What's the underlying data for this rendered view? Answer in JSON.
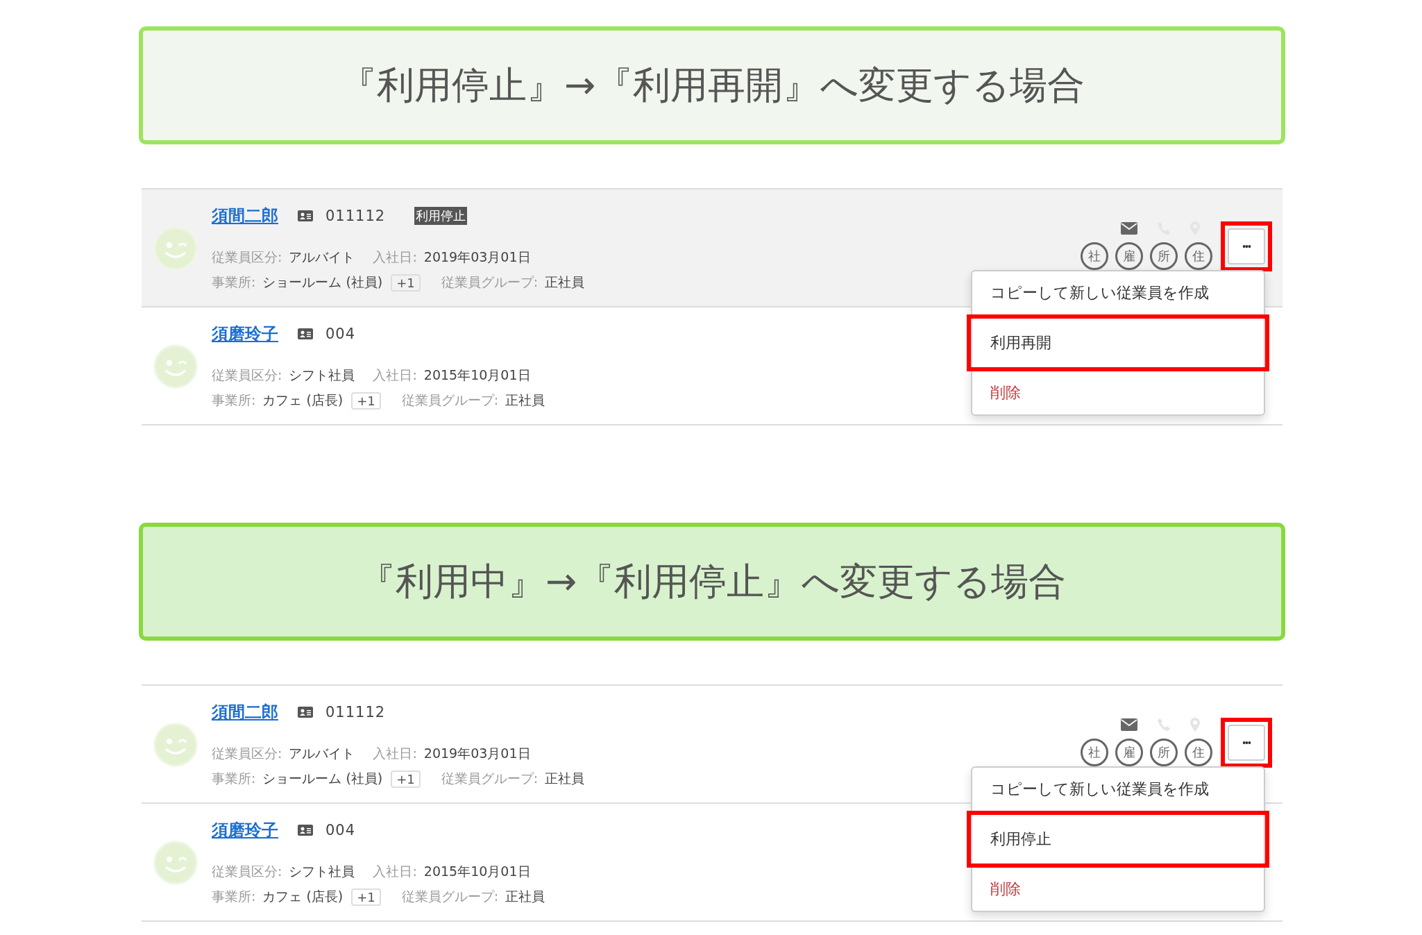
{
  "sections": [
    {
      "banner": {
        "title": "『利用停止』→『利用再開』へ変更する場合",
        "color": "#f1f6ee"
      },
      "employees": [
        {
          "name": "須間二郎",
          "employee_no": "011112",
          "status_tag": "利用停止",
          "hovered": true,
          "category_label": "従業員区分:",
          "category": "アルバイト",
          "hire_label": "入社日:",
          "hire_date": "2019年03月01日",
          "office_label": "事業所:",
          "office": "ショールーム (社員)",
          "office_extra": "+1",
          "group_label": "従業員グループ:",
          "group": "正社員",
          "contacts": [
            {
              "kind": "mail",
              "disabled": false
            },
            {
              "kind": "phone",
              "disabled": true
            },
            {
              "kind": "pin",
              "disabled": true
            }
          ],
          "badges": [
            "社",
            "雇",
            "所",
            "住"
          ],
          "more_button": {
            "label": "•••",
            "marked": true
          },
          "menu": [
            {
              "label": "コピーして新しい従業員を作成",
              "kind": "normal",
              "marked": false
            },
            {
              "label": "利用再開",
              "kind": "normal",
              "marked": true
            },
            {
              "label": "削除",
              "kind": "danger",
              "marked": false
            }
          ]
        },
        {
          "name": "須磨玲子",
          "employee_no": "004",
          "hovered": false,
          "category_label": "従業員区分:",
          "category": "シフト社員",
          "hire_label": "入社日:",
          "hire_date": "2015年10月01日",
          "office_label": "事業所:",
          "office": "カフェ (店長)",
          "office_extra": "+1",
          "group_label": "従業員グループ:",
          "group": "正社員"
        }
      ]
    },
    {
      "banner": {
        "title": "『利用中』→『利用停止』へ変更する場合",
        "color": "#d8f2cd"
      },
      "employees": [
        {
          "name": "須間二郎",
          "employee_no": "011112",
          "hovered": false,
          "category_label": "従業員区分:",
          "category": "アルバイト",
          "hire_label": "入社日:",
          "hire_date": "2019年03月01日",
          "office_label": "事業所:",
          "office": "ショールーム (社員)",
          "office_extra": "+1",
          "group_label": "従業員グループ:",
          "group": "正社員",
          "contacts": [
            {
              "kind": "mail",
              "disabled": false
            },
            {
              "kind": "phone",
              "disabled": true
            },
            {
              "kind": "pin",
              "disabled": true
            }
          ],
          "badges": [
            "社",
            "雇",
            "所",
            "住"
          ],
          "more_button": {
            "label": "•••",
            "marked": true
          },
          "menu": [
            {
              "label": "コピーして新しい従業員を作成",
              "kind": "normal",
              "marked": false
            },
            {
              "label": "利用停止",
              "kind": "normal",
              "marked": true
            },
            {
              "label": "削除",
              "kind": "danger",
              "marked": false
            }
          ]
        },
        {
          "name": "須磨玲子",
          "employee_no": "004",
          "hovered": false,
          "category_label": "従業員区分:",
          "category": "シフト社員",
          "hire_label": "入社日:",
          "hire_date": "2015年10月01日",
          "office_label": "事業所:",
          "office": "カフェ (店長)",
          "office_extra": "+1",
          "group_label": "従業員グループ:",
          "group": "正社員"
        }
      ]
    }
  ]
}
